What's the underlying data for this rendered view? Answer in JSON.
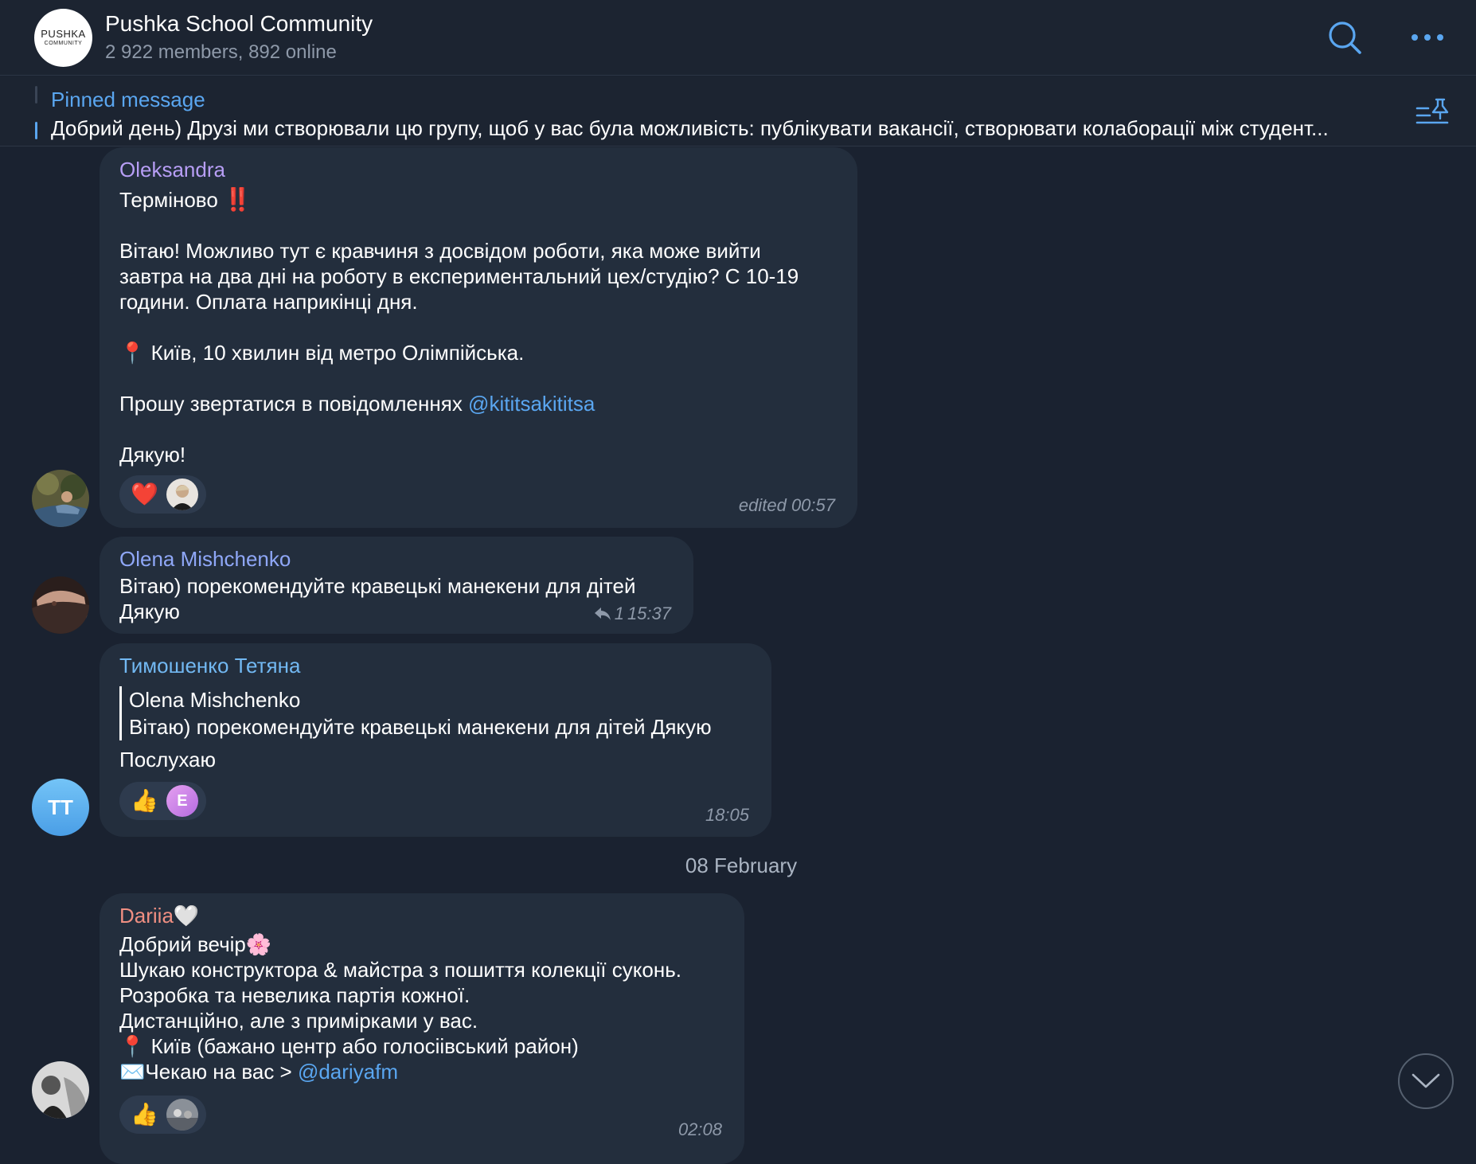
{
  "header": {
    "group_avatar_line1": "PUSHKA",
    "group_avatar_line2": "COMMUNITY",
    "title": "Pushka School Community",
    "subtitle": "2 922 members, 892 online",
    "search_icon": "search-icon",
    "more_icon": "more-icon"
  },
  "pinned": {
    "title": "Pinned message",
    "text": "Добрий день) Друзі ми створювали цю групу, щоб у вас була можливість: публікувати вакансії, створювати колаборації між студент...",
    "icon": "pinned-list-icon"
  },
  "colors": {
    "background": "#1a2230",
    "bubble": "#232e3d",
    "accent": "#5aa6f0",
    "name_oleksandra": "#b79ef5",
    "name_olena": "#8fa7f7",
    "name_tymoshenko": "#72b8f2",
    "name_dariia": "#f08f82"
  },
  "messages": [
    {
      "sender": "Oleksandra",
      "line1": "Терміново",
      "urgent_emoji": "‼️",
      "para1": "Вітаю! Можливо тут є кравчиня з досвідом роботи, яка може вийти\nзавтра на два дні на роботу в експериментальний цех/студію? С 10-19\nгодини. Оплата наприкінці дня.",
      "location_pin": "📍",
      "location": " Київ, 10 хвилин від метро Олімпійська.",
      "contact_prefix": "Прошу звертатися в повідомленнях ",
      "contact_link": "@kititsakititsa",
      "thanks": "Дякую!",
      "reaction_emoji": "❤️",
      "meta": "edited 00:57"
    },
    {
      "sender": "Olena Mishchenko",
      "line1": "Вітаю) порекомендуйте кравецькі манекени для дітей",
      "line2": "Дякую",
      "reply_count": "1",
      "time": "15:37"
    },
    {
      "sender": "Тимошенко Тетяна",
      "avatar_initials": "TT",
      "quote_name": "Olena Mishchenko",
      "quote_text": "Вітаю) порекомендуйте кравецькі манекени для дітей  Дякую",
      "text": "Послухаю",
      "reaction_emoji": "👍",
      "reactor_initial": "E",
      "time": "18:05"
    },
    {
      "sender": "Dariia",
      "sender_emoji": "🤍",
      "line1": "Добрий вечір",
      "line1_emoji": "🌸",
      "line2": "Шукаю конструктора & майстра з пошиття колекції суконь.",
      "line3": "Розробка та невелика партія кожної.",
      "line4": "Дистанційно, але з примірками у вас.",
      "location_pin": "📍",
      "location": " Київ (бажано центр або голосіівський район)",
      "envelope": "✉️",
      "contact_prefix": "Чекаю на вас > ",
      "contact_link": "@dariyafm",
      "reaction_emoji": "👍",
      "time": "02:08"
    }
  ],
  "date_separator": "08 February"
}
